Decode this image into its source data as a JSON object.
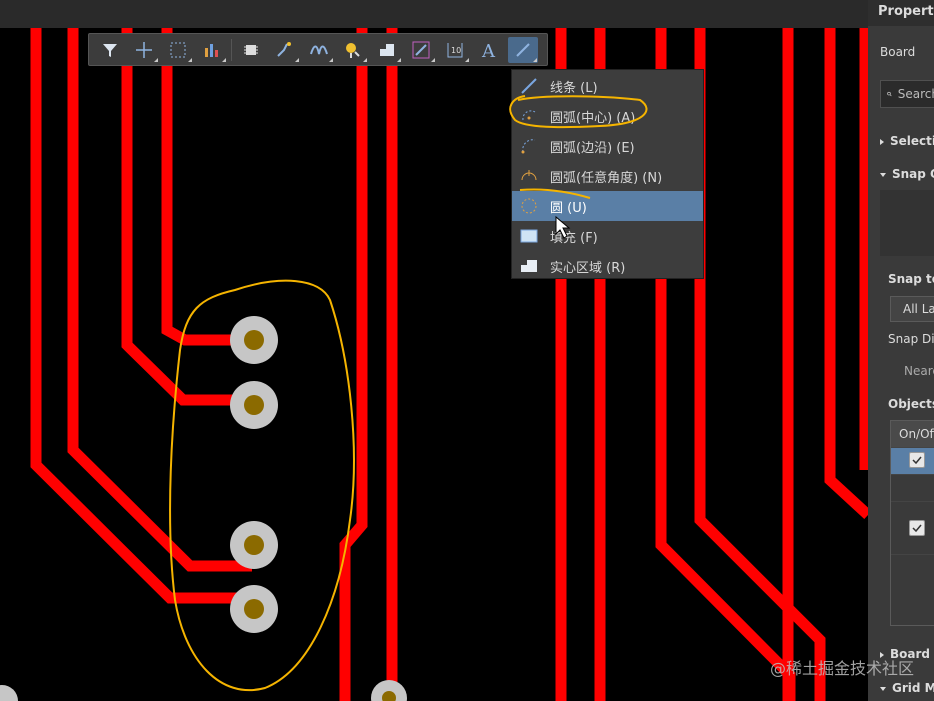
{
  "toolbar": {
    "icons": [
      "filter-icon",
      "cross-icon",
      "select-rect-icon",
      "chart-icon",
      "component-icon",
      "route-icon",
      "diff-pair-icon",
      "pin-icon",
      "polygon-icon",
      "track-icon",
      "dimension-icon",
      "text-icon",
      "line-icon"
    ],
    "text_glyph": "A"
  },
  "menu": {
    "items": [
      {
        "label": "线条 (L)",
        "icon": "line-icon",
        "selected": false
      },
      {
        "label": "圆弧(中心) (A)",
        "icon": "arc-center-icon",
        "selected": false
      },
      {
        "label": "圆弧(边沿) (E)",
        "icon": "arc-edge-icon",
        "selected": false
      },
      {
        "label": "圆弧(任意角度) (N)",
        "icon": "arc-any-icon",
        "selected": false
      },
      {
        "label": "圆 (U)",
        "icon": "circle-icon",
        "selected": true
      },
      {
        "label": "填充 (F)",
        "icon": "fill-icon",
        "selected": false
      },
      {
        "label": "实心区域 (R)",
        "icon": "solid-region-icon",
        "selected": false
      }
    ]
  },
  "panel": {
    "title": "Properties",
    "board": "Board",
    "search_placeholder": "Search",
    "selection": "Selection Filter",
    "snap_options": "Snap Options",
    "snap_to": "Snap to",
    "all_layers": "All Layers",
    "snap_distance": "Snap Distance",
    "nearest": "Nearest",
    "objects": "Objects for snapping",
    "on_off": "On/Off",
    "board_info": "Board Information",
    "grid_manager": "Grid Manager"
  },
  "watermark": "@稀土掘金技术社区",
  "colors": {
    "track": "#ff0000",
    "pad_ring": "#c0c0c0",
    "pad_hole": "#8b6a00",
    "annotation": "#f5b400",
    "menu_selected": "#5a7fa6"
  }
}
